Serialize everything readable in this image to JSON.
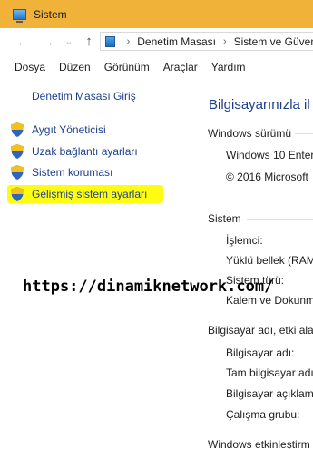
{
  "window": {
    "title": "Sistem"
  },
  "address": {
    "crumbs": [
      "Denetim Masası",
      "Sistem ve Güven"
    ],
    "separator": "›"
  },
  "nav": {
    "back": "←",
    "forward": "→",
    "dropdown": "⌄",
    "up": "↑"
  },
  "menu": [
    "Dosya",
    "Düzen",
    "Görünüm",
    "Araçlar",
    "Yardım"
  ],
  "left": {
    "home": "Denetim Masası Giriş",
    "tasks": [
      "Aygıt Yöneticisi",
      "Uzak bağlantı ayarları",
      "Sistem koruması",
      "Gelişmiş sistem ayarları"
    ],
    "highlight_color": "#fffc14"
  },
  "right": {
    "heading": "Bilgisayarınızla il",
    "edition_section": "Windows sürümü",
    "edition_items": [
      "Windows 10 Enter",
      "© 2016 Microsoft"
    ],
    "system_section": "Sistem",
    "system_items": [
      "İşlemci:",
      "Yüklü bellek (RAM",
      "Sistem türü:",
      "Kalem ve Dokunm"
    ],
    "computer_section": "Bilgisayar adı, etki alan",
    "computer_items": [
      "Bilgisayar adı:",
      "Tam bilgisayar adı",
      "Bilgisayar açıklama",
      "Çalışma grubu:"
    ],
    "activation_section": "Windows etkinleştirm"
  },
  "watermark": "https://dinamiknetwork.com/",
  "colors": {
    "titlebar": "#f0b238",
    "link": "#1c3f8c",
    "heading": "#1c3f8c"
  }
}
